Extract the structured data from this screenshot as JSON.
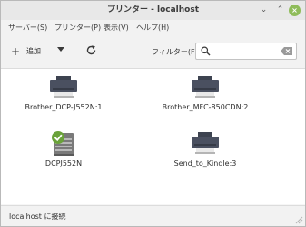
{
  "window": {
    "title": "プリンター - localhost",
    "minimize_glyph": "⌄",
    "maximize_glyph": "⌃",
    "close_glyph": "×",
    "accent_color": "#8fbc5a"
  },
  "menubar": {
    "items": [
      {
        "label": "サーバー(S)"
      },
      {
        "label": "プリンター(P)"
      },
      {
        "label": "表示(V)"
      },
      {
        "label": "ヘルプ(H)"
      }
    ]
  },
  "toolbar": {
    "add_icon": "plus-icon",
    "add_glyph": "+",
    "add_label": "追加",
    "dropdown_icon": "triangle-down-icon",
    "refresh_icon": "refresh-icon",
    "filter_label": "フィルター(F):",
    "search": {
      "icon": "search-icon",
      "value": "",
      "placeholder": "",
      "clear_icon": "clear-icon"
    }
  },
  "printers": [
    {
      "name": "Brother_DCP-J552N:1",
      "icon": "printer-icon",
      "is_default": false
    },
    {
      "name": "Brother_MFC-850CDN:2",
      "icon": "printer-icon",
      "is_default": false
    },
    {
      "name": "DCPJ552N",
      "icon": "default-printer-icon",
      "is_default": true
    },
    {
      "name": "Send_to_Kindle:3",
      "icon": "printer-icon",
      "is_default": false
    }
  ],
  "statusbar": {
    "text": "localhost に接続"
  }
}
